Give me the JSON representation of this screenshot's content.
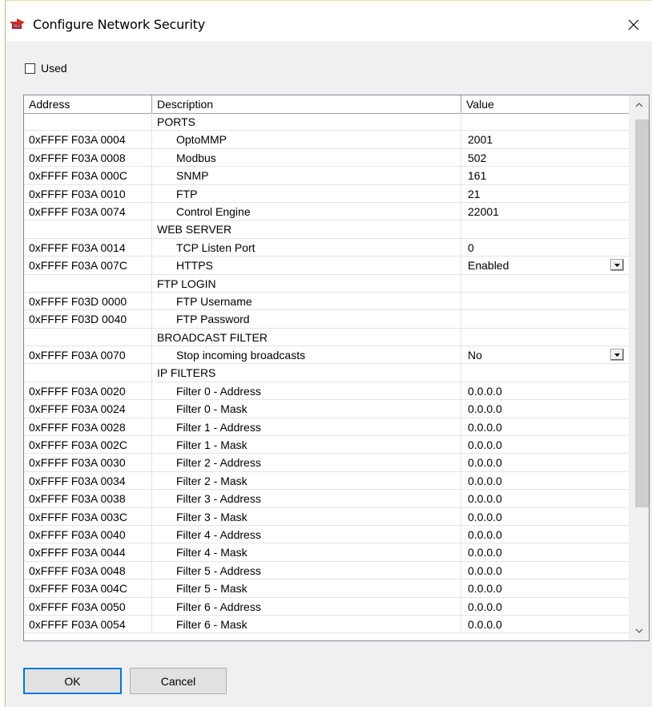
{
  "window": {
    "title": "Configure Network Security"
  },
  "used_label": "Used",
  "columns": {
    "address": "Address",
    "description": "Description",
    "value": "Value"
  },
  "rows": [
    {
      "address": "",
      "description": "PORTS",
      "value": "",
      "header": true
    },
    {
      "address": "0xFFFF F03A 0004",
      "description": "OptoMMP",
      "value": "2001"
    },
    {
      "address": "0xFFFF F03A 0008",
      "description": "Modbus",
      "value": "502"
    },
    {
      "address": "0xFFFF F03A 000C",
      "description": "SNMP",
      "value": "161"
    },
    {
      "address": "0xFFFF F03A 0010",
      "description": "FTP",
      "value": "21"
    },
    {
      "address": "0xFFFF F03A 0074",
      "description": "Control Engine",
      "value": "22001"
    },
    {
      "address": "",
      "description": "WEB SERVER",
      "value": "",
      "header": true
    },
    {
      "address": "0xFFFF F03A 0014",
      "description": "TCP Listen Port",
      "value": "0"
    },
    {
      "address": "0xFFFF F03A 007C",
      "description": "HTTPS",
      "value": "Enabled",
      "dropdown": true
    },
    {
      "address": "",
      "description": "FTP LOGIN",
      "value": "",
      "header": true
    },
    {
      "address": "0xFFFF F03D 0000",
      "description": "FTP Username",
      "value": ""
    },
    {
      "address": "0xFFFF F03D 0040",
      "description": "FTP Password",
      "value": ""
    },
    {
      "address": "",
      "description": "BROADCAST FILTER",
      "value": "",
      "header": true
    },
    {
      "address": "0xFFFF F03A 0070",
      "description": "Stop incoming broadcasts",
      "value": "No",
      "dropdown": true
    },
    {
      "address": "",
      "description": "IP FILTERS",
      "value": "",
      "header": true
    },
    {
      "address": "0xFFFF F03A 0020",
      "description": "Filter 0 - Address",
      "value": "0.0.0.0"
    },
    {
      "address": "0xFFFF F03A 0024",
      "description": "Filter 0 - Mask",
      "value": "0.0.0.0"
    },
    {
      "address": "0xFFFF F03A 0028",
      "description": "Filter 1 - Address",
      "value": "0.0.0.0"
    },
    {
      "address": "0xFFFF F03A 002C",
      "description": "Filter 1 - Mask",
      "value": "0.0.0.0"
    },
    {
      "address": "0xFFFF F03A 0030",
      "description": "Filter 2 - Address",
      "value": "0.0.0.0"
    },
    {
      "address": "0xFFFF F03A 0034",
      "description": "Filter 2 - Mask",
      "value": "0.0.0.0"
    },
    {
      "address": "0xFFFF F03A 0038",
      "description": "Filter 3 - Address",
      "value": "0.0.0.0"
    },
    {
      "address": "0xFFFF F03A 003C",
      "description": "Filter 3 - Mask",
      "value": "0.0.0.0"
    },
    {
      "address": "0xFFFF F03A 0040",
      "description": "Filter 4 - Address",
      "value": "0.0.0.0"
    },
    {
      "address": "0xFFFF F03A 0044",
      "description": "Filter 4 - Mask",
      "value": "0.0.0.0"
    },
    {
      "address": "0xFFFF F03A 0048",
      "description": "Filter 5 - Address",
      "value": "0.0.0.0"
    },
    {
      "address": "0xFFFF F03A 004C",
      "description": "Filter 5 - Mask",
      "value": "0.0.0.0"
    },
    {
      "address": "0xFFFF F03A 0050",
      "description": "Filter 6 - Address",
      "value": "0.0.0.0"
    },
    {
      "address": "0xFFFF F03A 0054",
      "description": "Filter 6 - Mask",
      "value": "0.0.0.0"
    }
  ],
  "buttons": {
    "ok": "OK",
    "cancel": "Cancel"
  },
  "icons": {
    "app": "network-security-icon",
    "close": "close-icon",
    "dropdown": "chevron-down-icon",
    "scroll_up": "scroll-up-icon",
    "scroll_down": "scroll-down-icon"
  },
  "colors": {
    "ok_border": "#0078d7",
    "dialog_bg": "#f0f0f0",
    "scroll_thumb": "#cdcdcd"
  }
}
